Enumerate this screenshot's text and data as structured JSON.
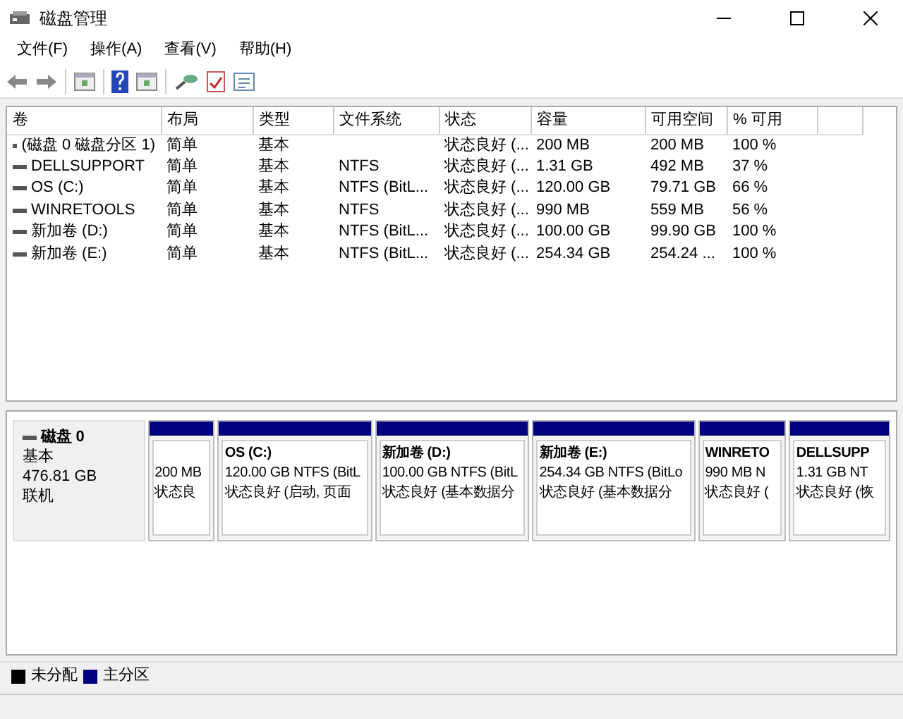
{
  "window": {
    "title": "磁盘管理"
  },
  "menu": [
    "文件(F)",
    "操作(A)",
    "查看(V)",
    "帮助(H)"
  ],
  "table": {
    "columns": [
      "卷",
      "布局",
      "类型",
      "文件系统",
      "状态",
      "容量",
      "可用空间",
      "% 可用"
    ],
    "rows": [
      [
        "(磁盘 0 磁盘分区 1)",
        "简单",
        "基本",
        "",
        "状态良好 (...",
        "200 MB",
        "200 MB",
        "100 %"
      ],
      [
        "DELLSUPPORT",
        "简单",
        "基本",
        "NTFS",
        "状态良好 (...",
        "1.31 GB",
        "492 MB",
        "37 %"
      ],
      [
        "OS (C:)",
        "简单",
        "基本",
        "NTFS (BitL...",
        "状态良好 (...",
        "120.00 GB",
        "79.71 GB",
        "66 %"
      ],
      [
        "WINRETOOLS",
        "简单",
        "基本",
        "NTFS",
        "状态良好 (...",
        "990 MB",
        "559 MB",
        "56 %"
      ],
      [
        "新加卷 (D:)",
        "简单",
        "基本",
        "NTFS (BitL...",
        "状态良好 (...",
        "100.00 GB",
        "99.90 GB",
        "100 %"
      ],
      [
        "新加卷 (E:)",
        "简单",
        "基本",
        "NTFS (BitL...",
        "状态良好 (...",
        "254.34 GB",
        "254.24 ...",
        "100 %"
      ]
    ]
  },
  "disk": {
    "name": "磁盘 0",
    "type": "基本",
    "size": "476.81 GB",
    "status": "联机"
  },
  "partitions": [
    {
      "size": "200 MB",
      "status": "状态良"
    },
    {
      "title": "OS  (C:)",
      "size": "120.00 GB NTFS (BitL",
      "status": "状态良好 (启动, 页面"
    },
    {
      "title": "新加卷  (D:)",
      "size": "100.00 GB NTFS (BitL",
      "status": "状态良好 (基本数据分"
    },
    {
      "title": "新加卷  (E:)",
      "size": "254.34 GB NTFS (BitLo",
      "status": "状态良好 (基本数据分"
    },
    {
      "title": "WINRETO",
      "size": "990 MB N",
      "status": "状态良好 ("
    },
    {
      "title": "DELLSUPP",
      "size": "1.31 GB NT",
      "status": "状态良好 (恢"
    }
  ],
  "legend": [
    {
      "label": "未分配",
      "color": "#000000"
    },
    {
      "label": "主分区",
      "color": "#000080"
    }
  ]
}
